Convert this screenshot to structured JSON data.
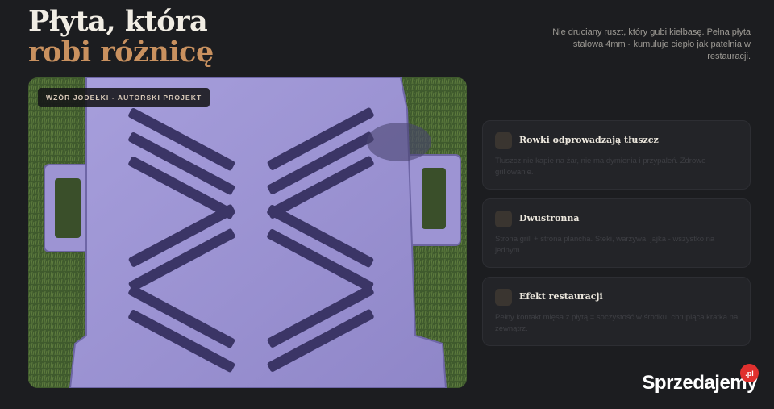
{
  "hero": {
    "title_line1": "Płyta, która",
    "title_line2": "robi różnicę",
    "description": "Nie druciany ruszt, który gubi kiełbasę. Pełna płyta stalowa 4mm - kumuluje ciepło jak patelnia w restauracji."
  },
  "photo": {
    "badge": "WZÓR JODEŁKI - AUTORSKI PROJEKT"
  },
  "features": [
    {
      "icon": "square-icon",
      "title": "Rowki odprowadzają tłuszcz",
      "text": "Tłuszcz nie kapie na żar, nie ma dymienia i przypaleń. Zdrowe grillowanie."
    },
    {
      "icon": "square-icon",
      "title": "Dwustronna",
      "text": "Strona grill + strona plancha. Steki, warzywa, jajka - wszystko na jednym."
    },
    {
      "icon": "square-icon",
      "title": "Efekt restauracji",
      "text": "Pełny kontakt mięsa z płytą = soczystość w środku, chrupiąca kratka na zewnątrz."
    }
  ],
  "watermark": {
    "text": "Sprzedajemy",
    "suffix": ".pl"
  },
  "colors": {
    "background": "#1c1d20",
    "accent": "#c9915f",
    "card": "#232428",
    "plate": "#a59bd6"
  }
}
